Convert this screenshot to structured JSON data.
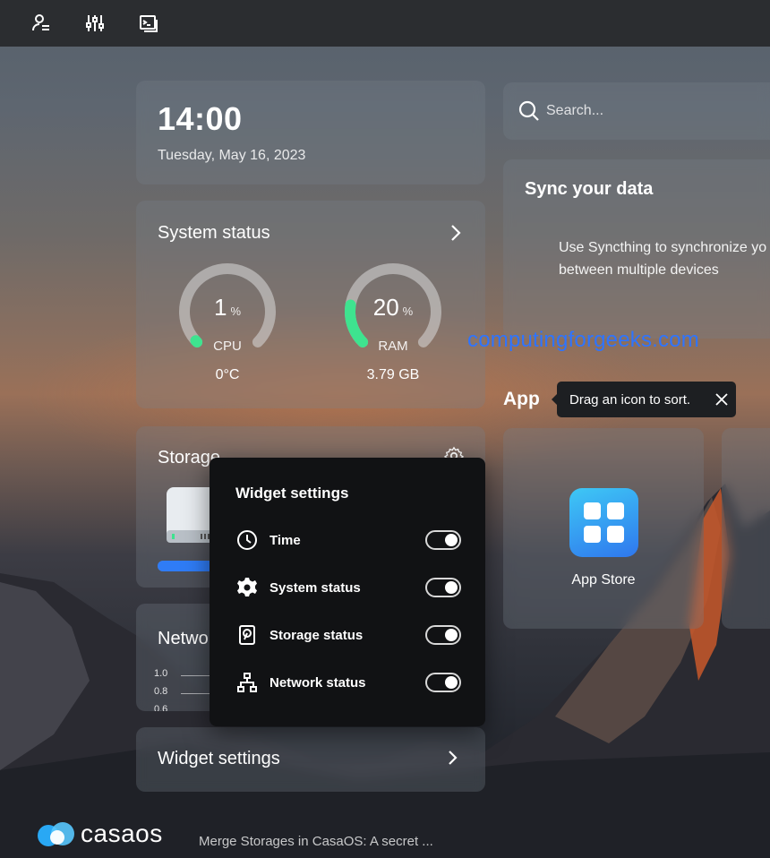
{
  "topbar": {
    "icons": [
      "account-icon",
      "settings-sliders-icon",
      "terminal-icon"
    ]
  },
  "time_widget": {
    "time": "14:00",
    "date": "Tuesday, May 16, 2023"
  },
  "system_status": {
    "title": "System status",
    "cpu": {
      "value": "1",
      "unit": "%",
      "label": "CPU",
      "sub": "0°C",
      "fraction": 0.01
    },
    "ram": {
      "value": "20",
      "unit": "%",
      "label": "RAM",
      "sub": "3.79 GB",
      "fraction": 0.2
    }
  },
  "storage": {
    "title": "Storage",
    "usage_fraction": 0.2
  },
  "network": {
    "title": "Network",
    "axis_ticks": [
      "1.0",
      "0.8",
      "0.6"
    ]
  },
  "widget_settings_link": {
    "label": "Widget settings"
  },
  "popover": {
    "title": "Widget settings",
    "items": [
      {
        "label": "Time",
        "icon": "clock-icon",
        "enabled": true
      },
      {
        "label": "System status",
        "icon": "gear-icon",
        "enabled": true
      },
      {
        "label": "Storage status",
        "icon": "hard-disk-icon",
        "enabled": true
      },
      {
        "label": "Network status",
        "icon": "network-icon",
        "enabled": true
      }
    ]
  },
  "search": {
    "placeholder": "Search..."
  },
  "sync": {
    "title": "Sync your data",
    "body_line1": "Use Syncthing to synchronize yo",
    "body_line2": "between multiple devices"
  },
  "watermark": "computingforgeeks.com",
  "apps": {
    "heading": "App",
    "tooltip": "Drag an icon to sort.",
    "items": [
      {
        "name": "App Store",
        "icon": "app-store-icon"
      }
    ]
  },
  "footer": {
    "logo_text": "casaos",
    "news": "Merge Storages in CasaOS: A secret ..."
  },
  "colors": {
    "accent_blue": "#2f7cf6",
    "gauge_green": "#3ee38f",
    "watermark_blue": "#2e74ff"
  }
}
